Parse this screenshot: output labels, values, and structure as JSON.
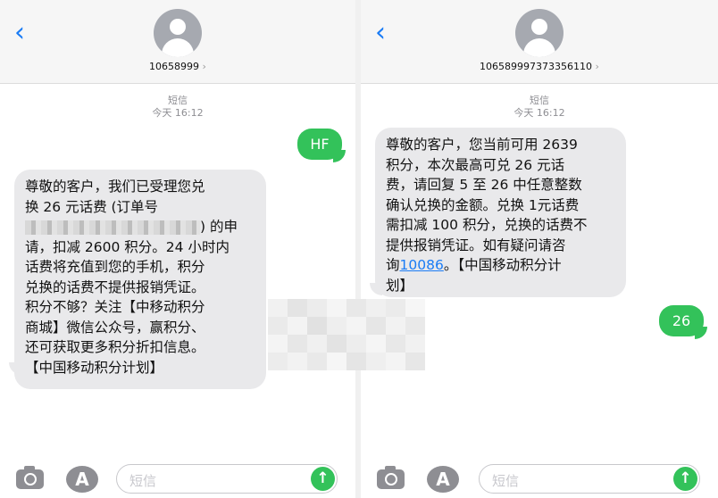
{
  "left": {
    "contact": "10658999",
    "meta_label": "短信",
    "meta_time": "今天 16:12",
    "out_message": "HF",
    "in_lines": [
      "尊敬的客户，我们已受理您兑",
      "换 26 元话费 (订单号",
      ") 的申",
      "请，扣减 2600 积分。24 小时内",
      "话费将充值到您的手机，积分",
      "兑换的话费不提供报销凭证。",
      "积分不够？关注【中移动积分",
      "商城】微信公众号，赢积分、",
      "还可获取更多积分折扣信息。",
      "【中国移动积分计划】"
    ],
    "input_placeholder": "短信"
  },
  "right": {
    "contact": "106589997373356110",
    "meta_label": "短信",
    "meta_time": "今天 16:12",
    "in_lines": [
      "尊敬的客户，您当前可用 2639",
      "积分，本次最高可兑 26 元话",
      "费，请回复 5 至 26 中任意整数",
      "确认兑换的金额。兑换 1元话费",
      "需扣减 100 积分，兑换的话费不",
      "提供报销凭证。如有疑问请咨"
    ],
    "in_link_prefix": "询",
    "in_link": "10086",
    "in_link_suffix": "。【中国移动积分计",
    "in_last_line": "划】",
    "out_message": "26",
    "input_placeholder": "短信"
  },
  "icons": [
    "back-chevron-icon",
    "contact-avatar-icon",
    "camera-icon",
    "app-store-icon",
    "send-arrow-icon"
  ],
  "colors": {
    "accent_blue": "#1a7cf5",
    "outgoing_green": "#33c25a",
    "incoming_gray": "#e9e9eb"
  }
}
